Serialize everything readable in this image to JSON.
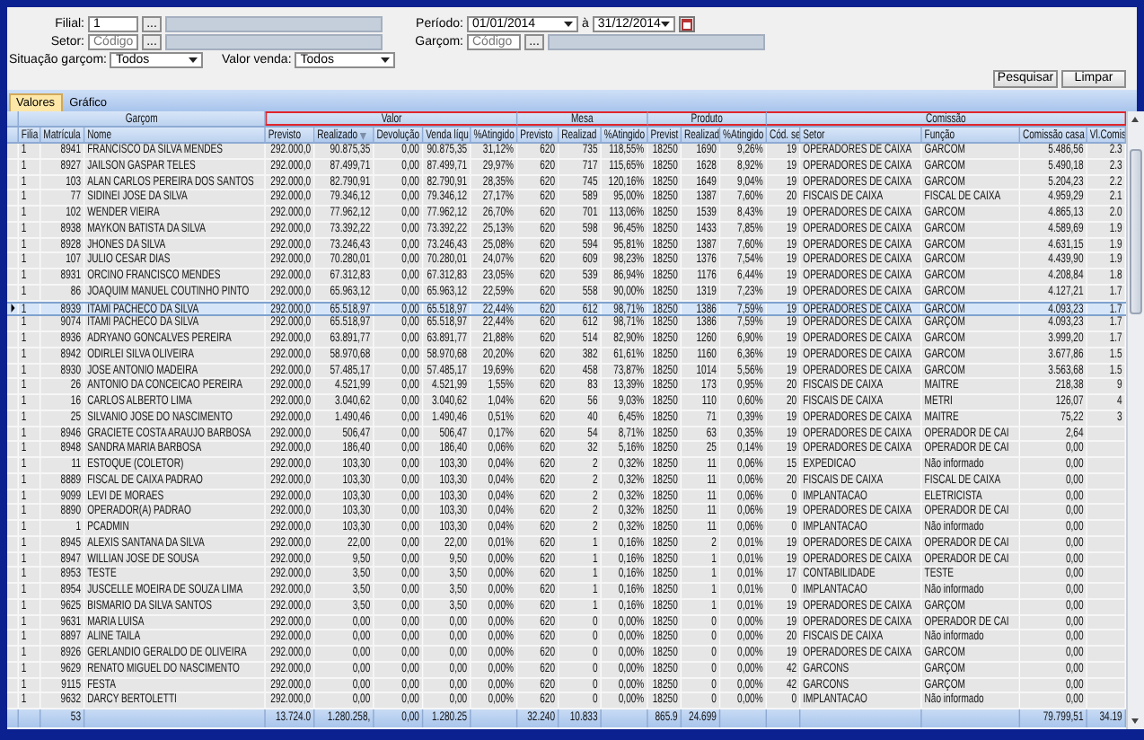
{
  "filters": {
    "filial": {
      "label": "Filial:",
      "value": "1",
      "button": "..."
    },
    "setor": {
      "label": "Setor:",
      "placeholder": "Código",
      "button": "..."
    },
    "situacao_garcom": {
      "label": "Situação garçom:",
      "value": "Todos"
    },
    "valor_venda": {
      "label": "Valor venda:",
      "value": "Todos"
    },
    "periodo": {
      "label": "Período:",
      "from": "01/01/2014",
      "separator": "à",
      "to": "31/12/2014"
    },
    "garcom": {
      "label": "Garçom:",
      "placeholder": "Código",
      "button": "..."
    }
  },
  "buttons": [
    {
      "label": "Pesquisar"
    },
    {
      "label": "Limpar"
    }
  ],
  "tabs": [
    {
      "label": "Valores",
      "selected": true
    },
    {
      "label": "Gráfico",
      "selected": false
    }
  ],
  "table": {
    "groups": [
      {
        "label": "Garçom",
        "highlighted": false,
        "columns": [
          {
            "label": "Filia",
            "sorted": false
          },
          {
            "label": "Matrícula",
            "sorted": false,
            "total": "53"
          },
          {
            "label": "Nome",
            "sorted": false
          }
        ]
      },
      {
        "label": "Valor",
        "highlighted": true,
        "columns": [
          {
            "label": "Previsto",
            "sorted": false,
            "total": "13.724.0"
          },
          {
            "label": "Realizado",
            "sorted": true,
            "total": "1.280.258,"
          },
          {
            "label": "Devolução",
            "sorted": false,
            "total": "0,00"
          },
          {
            "label": "Venda líqu",
            "sorted": false,
            "total": "1.280.25"
          },
          {
            "label": "%Atingido",
            "sorted": false
          }
        ]
      },
      {
        "label": "Mesa",
        "highlighted": true,
        "columns": [
          {
            "label": "Previsto",
            "sorted": false,
            "total": "32.240"
          },
          {
            "label": "Realizad",
            "sorted": false,
            "total": "10.833"
          },
          {
            "label": "%Atingido",
            "sorted": false
          }
        ]
      },
      {
        "label": "Produto",
        "highlighted": true,
        "columns": [
          {
            "label": "Previst",
            "sorted": false,
            "total": "865.9"
          },
          {
            "label": "Realizad",
            "sorted": false,
            "total": "24.699"
          },
          {
            "label": "%Atingido",
            "sorted": false
          }
        ]
      },
      {
        "label": "Comissão",
        "highlighted": true,
        "columns": [
          {
            "label": "Cód. se",
            "sorted": false
          },
          {
            "label": "Setor",
            "sorted": false
          },
          {
            "label": "Função",
            "sorted": false
          },
          {
            "label": "Comissão casa",
            "sorted": false,
            "total": "79.799,51"
          },
          {
            "label": "Vl.Comis",
            "sorted": false,
            "total": "34.19"
          }
        ]
      }
    ],
    "rows": [
      {
        "selected": false,
        "cells": [
          "1",
          "8941",
          "FRANCISCO DA SILVA MENDES",
          "292.000,0",
          "90.875,35",
          "0,00",
          "90.875,35",
          "31,12%",
          "620",
          "735",
          "118,55%",
          "18250",
          "1690",
          "9,26%",
          "19",
          "OPERADORES DE CAIXA",
          "GARCOM",
          "5.486,56",
          "2.3"
        ]
      },
      {
        "selected": false,
        "cells": [
          "1",
          "8927",
          "JAILSON GASPAR TELES",
          "292.000,0",
          "87.499,71",
          "0,00",
          "87.499,71",
          "29,97%",
          "620",
          "717",
          "115,65%",
          "18250",
          "1628",
          "8,92%",
          "19",
          "OPERADORES DE CAIXA",
          "GARCOM",
          "5.490,18",
          "2.3"
        ]
      },
      {
        "selected": false,
        "cells": [
          "1",
          "103",
          "ALAN CARLOS PEREIRA DOS SANTOS",
          "292.000,0",
          "82.790,91",
          "0,00",
          "82.790,91",
          "28,35%",
          "620",
          "745",
          "120,16%",
          "18250",
          "1649",
          "9,04%",
          "19",
          "OPERADORES DE CAIXA",
          "GARCOM",
          "5.204,23",
          "2.2"
        ]
      },
      {
        "selected": false,
        "cells": [
          "1",
          "77",
          "SIDINEI JOSE DA SILVA",
          "292.000,0",
          "79.346,12",
          "0,00",
          "79.346,12",
          "27,17%",
          "620",
          "589",
          "95,00%",
          "18250",
          "1387",
          "7,60%",
          "20",
          "FISCAIS DE CAIXA",
          "FISCAL DE CAIXA",
          "4.959,29",
          "2.1"
        ]
      },
      {
        "selected": false,
        "cells": [
          "1",
          "102",
          "WENDER VIEIRA",
          "292.000,0",
          "77.962,12",
          "0,00",
          "77.962,12",
          "26,70%",
          "620",
          "701",
          "113,06%",
          "18250",
          "1539",
          "8,43%",
          "19",
          "OPERADORES DE CAIXA",
          "GARCOM",
          "4.865,13",
          "2.0"
        ]
      },
      {
        "selected": false,
        "cells": [
          "1",
          "8938",
          "MAYKON BATISTA DA SILVA",
          "292.000,0",
          "73.392,22",
          "0,00",
          "73.392,22",
          "25,13%",
          "620",
          "598",
          "96,45%",
          "18250",
          "1433",
          "7,85%",
          "19",
          "OPERADORES DE CAIXA",
          "GARCOM",
          "4.589,69",
          "1.9"
        ]
      },
      {
        "selected": false,
        "cells": [
          "1",
          "8928",
          "JHONES DA SILVA",
          "292.000,0",
          "73.246,43",
          "0,00",
          "73.246,43",
          "25,08%",
          "620",
          "594",
          "95,81%",
          "18250",
          "1387",
          "7,60%",
          "19",
          "OPERADORES DE CAIXA",
          "GARCOM",
          "4.631,15",
          "1.9"
        ]
      },
      {
        "selected": false,
        "cells": [
          "1",
          "107",
          "JULIO CESAR DIAS",
          "292.000,0",
          "70.280,01",
          "0,00",
          "70.280,01",
          "24,07%",
          "620",
          "609",
          "98,23%",
          "18250",
          "1376",
          "7,54%",
          "19",
          "OPERADORES DE CAIXA",
          "GARCOM",
          "4.439,90",
          "1.9"
        ]
      },
      {
        "selected": false,
        "cells": [
          "1",
          "8931",
          "ORCINO FRANCISCO MENDES",
          "292.000,0",
          "67.312,83",
          "0,00",
          "67.312,83",
          "23,05%",
          "620",
          "539",
          "86,94%",
          "18250",
          "1176",
          "6,44%",
          "19",
          "OPERADORES DE CAIXA",
          "GARCOM",
          "4.208,84",
          "1.8"
        ]
      },
      {
        "selected": false,
        "cells": [
          "1",
          "86",
          "JOAQUIM MANUEL COUTINHO PINTO",
          "292.000,0",
          "65.963,12",
          "0,00",
          "65.963,12",
          "22,59%",
          "620",
          "558",
          "90,00%",
          "18250",
          "1319",
          "7,23%",
          "19",
          "OPERADORES DE CAIXA",
          "GARCOM",
          "4.127,21",
          "1.7"
        ]
      },
      {
        "selected": true,
        "cells": [
          "1",
          "8939",
          "ITAMI PACHECO DA SILVA",
          "292.000,0",
          "65.518,97",
          "0,00",
          "65.518,97",
          "22,44%",
          "620",
          "612",
          "98,71%",
          "18250",
          "1386",
          "7,59%",
          "19",
          "OPERADORES DE CAIXA",
          "GARCOM",
          "4.093,23",
          "1.7"
        ]
      },
      {
        "selected": false,
        "cells": [
          "1",
          "9074",
          "ITAMI PACHECO DA SILVA",
          "292.000,0",
          "65.518,97",
          "0,00",
          "65.518,97",
          "22,44%",
          "620",
          "612",
          "98,71%",
          "18250",
          "1386",
          "7,59%",
          "19",
          "OPERADORES DE CAIXA",
          "GARÇOM",
          "4.093,23",
          "1.7"
        ]
      },
      {
        "selected": false,
        "cells": [
          "1",
          "8936",
          "ADRYANO GONCALVES PEREIRA",
          "292.000,0",
          "63.891,77",
          "0,00",
          "63.891,77",
          "21,88%",
          "620",
          "514",
          "82,90%",
          "18250",
          "1260",
          "6,90%",
          "19",
          "OPERADORES DE CAIXA",
          "GARCOM",
          "3.999,20",
          "1.7"
        ]
      },
      {
        "selected": false,
        "cells": [
          "1",
          "8942",
          "ODIRLEI SILVA OLIVEIRA",
          "292.000,0",
          "58.970,68",
          "0,00",
          "58.970,68",
          "20,20%",
          "620",
          "382",
          "61,61%",
          "18250",
          "1160",
          "6,36%",
          "19",
          "OPERADORES DE CAIXA",
          "GARCOM",
          "3.677,86",
          "1.5"
        ]
      },
      {
        "selected": false,
        "cells": [
          "1",
          "8930",
          "JOSE ANTONIO MADEIRA",
          "292.000,0",
          "57.485,17",
          "0,00",
          "57.485,17",
          "19,69%",
          "620",
          "458",
          "73,87%",
          "18250",
          "1014",
          "5,56%",
          "19",
          "OPERADORES DE CAIXA",
          "GARCOM",
          "3.563,68",
          "1.5"
        ]
      },
      {
        "selected": false,
        "cells": [
          "1",
          "26",
          "ANTONIO DA CONCEICAO PEREIRA",
          "292.000,0",
          "4.521,99",
          "0,00",
          "4.521,99",
          "1,55%",
          "620",
          "83",
          "13,39%",
          "18250",
          "173",
          "0,95%",
          "20",
          "FISCAIS DE CAIXA",
          "MAITRE",
          "218,38",
          "9"
        ]
      },
      {
        "selected": false,
        "cells": [
          "1",
          "16",
          "CARLOS ALBERTO LIMA",
          "292.000,0",
          "3.040,62",
          "0,00",
          "3.040,62",
          "1,04%",
          "620",
          "56",
          "9,03%",
          "18250",
          "110",
          "0,60%",
          "20",
          "FISCAIS DE CAIXA",
          "METRI",
          "126,07",
          "4"
        ]
      },
      {
        "selected": false,
        "cells": [
          "1",
          "25",
          "SILVANIO JOSE DO NASCIMENTO",
          "292.000,0",
          "1.490,46",
          "0,00",
          "1.490,46",
          "0,51%",
          "620",
          "40",
          "6,45%",
          "18250",
          "71",
          "0,39%",
          "19",
          "OPERADORES DE CAIXA",
          "MAITRE",
          "75,22",
          "3"
        ]
      },
      {
        "selected": false,
        "cells": [
          "1",
          "8946",
          "GRACIETE COSTA ARAUJO BARBOSA",
          "292.000,0",
          "506,47",
          "0,00",
          "506,47",
          "0,17%",
          "620",
          "54",
          "8,71%",
          "18250",
          "63",
          "0,35%",
          "19",
          "OPERADORES DE CAIXA",
          "OPERADOR DE CAI",
          "2,64"
        ]
      },
      {
        "selected": false,
        "cells": [
          "1",
          "8948",
          "SANDRA MARIA BARBOSA",
          "292.000,0",
          "186,40",
          "0,00",
          "186,40",
          "0,06%",
          "620",
          "32",
          "5,16%",
          "18250",
          "25",
          "0,14%",
          "19",
          "OPERADORES DE CAIXA",
          "OPERADOR DE CAI",
          "0,00"
        ]
      },
      {
        "selected": false,
        "cells": [
          "1",
          "11",
          "ESTOQUE (COLETOR)",
          "292.000,0",
          "103,30",
          "0,00",
          "103,30",
          "0,04%",
          "620",
          "2",
          "0,32%",
          "18250",
          "11",
          "0,06%",
          "15",
          "EXPEDICAO",
          "Não informado",
          "0,00"
        ]
      },
      {
        "selected": false,
        "cells": [
          "1",
          "8889",
          "FISCAL DE CAIXA PADRAO",
          "292.000,0",
          "103,30",
          "0,00",
          "103,30",
          "0,04%",
          "620",
          "2",
          "0,32%",
          "18250",
          "11",
          "0,06%",
          "20",
          "FISCAIS DE CAIXA",
          "FISCAL DE CAIXA",
          "0,00"
        ]
      },
      {
        "selected": false,
        "cells": [
          "1",
          "9099",
          "LEVI DE MORAES",
          "292.000,0",
          "103,30",
          "0,00",
          "103,30",
          "0,04%",
          "620",
          "2",
          "0,32%",
          "18250",
          "11",
          "0,06%",
          "0",
          "IMPLANTACAO",
          "ELETRICISTA",
          "0,00"
        ]
      },
      {
        "selected": false,
        "cells": [
          "1",
          "8890",
          "OPERADOR(A) PADRAO",
          "292.000,0",
          "103,30",
          "0,00",
          "103,30",
          "0,04%",
          "620",
          "2",
          "0,32%",
          "18250",
          "11",
          "0,06%",
          "19",
          "OPERADORES DE CAIXA",
          "OPERADOR DE CAI",
          "0,00"
        ]
      },
      {
        "selected": false,
        "cells": [
          "1",
          "1",
          "PCADMIN",
          "292.000,0",
          "103,30",
          "0,00",
          "103,30",
          "0,04%",
          "620",
          "2",
          "0,32%",
          "18250",
          "11",
          "0,06%",
          "0",
          "IMPLANTACAO",
          "Não informado",
          "0,00"
        ]
      },
      {
        "selected": false,
        "cells": [
          "1",
          "8945",
          "ALEXIS SANTANA DA SILVA",
          "292.000,0",
          "22,00",
          "0,00",
          "22,00",
          "0,01%",
          "620",
          "1",
          "0,16%",
          "18250",
          "2",
          "0,01%",
          "19",
          "OPERADORES DE CAIXA",
          "OPERADOR DE CAI",
          "0,00"
        ]
      },
      {
        "selected": false,
        "cells": [
          "1",
          "8947",
          "WILLIAN JOSE DE SOUSA",
          "292.000,0",
          "9,50",
          "0,00",
          "9,50",
          "0,00%",
          "620",
          "1",
          "0,16%",
          "18250",
          "1",
          "0,01%",
          "19",
          "OPERADORES DE CAIXA",
          "OPERADOR DE CAI",
          "0,00"
        ]
      },
      {
        "selected": false,
        "cells": [
          "1",
          "8953",
          "TESTE",
          "292.000,0",
          "3,50",
          "0,00",
          "3,50",
          "0,00%",
          "620",
          "1",
          "0,16%",
          "18250",
          "1",
          "0,01%",
          "17",
          "CONTABILIDADE",
          "TESTE",
          "0,00"
        ]
      },
      {
        "selected": false,
        "cells": [
          "1",
          "8954",
          "JUSCELLE MOEIRA DE SOUZA LIMA",
          "292.000,0",
          "3,50",
          "0,00",
          "3,50",
          "0,00%",
          "620",
          "1",
          "0,16%",
          "18250",
          "1",
          "0,01%",
          "0",
          "IMPLANTACAO",
          "Não informado",
          "0,00"
        ]
      },
      {
        "selected": false,
        "cells": [
          "1",
          "9625",
          "BISMARIO DA SILVA SANTOS",
          "292.000,0",
          "3,50",
          "0,00",
          "3,50",
          "0,00%",
          "620",
          "1",
          "0,16%",
          "18250",
          "1",
          "0,01%",
          "19",
          "OPERADORES DE CAIXA",
          "GARÇOM",
          "0,00"
        ]
      },
      {
        "selected": false,
        "cells": [
          "1",
          "9631",
          "MARIA LUISA",
          "292.000,0",
          "0,00",
          "0,00",
          "0,00",
          "0,00%",
          "620",
          "0",
          "0,00%",
          "18250",
          "0",
          "0,00%",
          "19",
          "OPERADORES DE CAIXA",
          "OPERADOR DE CAI",
          "0,00"
        ]
      },
      {
        "selected": false,
        "cells": [
          "1",
          "8897",
          "ALINE TAILA",
          "292.000,0",
          "0,00",
          "0,00",
          "0,00",
          "0,00%",
          "620",
          "0",
          "0,00%",
          "18250",
          "0",
          "0,00%",
          "20",
          "FISCAIS DE CAIXA",
          "Não informado",
          "0,00"
        ]
      },
      {
        "selected": false,
        "cells": [
          "1",
          "8926",
          "GERLANDIO GERALDO DE OLIVEIRA",
          "292.000,0",
          "0,00",
          "0,00",
          "0,00",
          "0,00%",
          "620",
          "0",
          "0,00%",
          "18250",
          "0",
          "0,00%",
          "19",
          "OPERADORES DE CAIXA",
          "GARCOM",
          "0,00"
        ]
      },
      {
        "selected": false,
        "cells": [
          "1",
          "9629",
          "RENATO MIGUEL DO NASCIMENTO",
          "292.000,0",
          "0,00",
          "0,00",
          "0,00",
          "0,00%",
          "620",
          "0",
          "0,00%",
          "18250",
          "0",
          "0,00%",
          "42",
          "GARCONS",
          "GARÇOM",
          "0,00"
        ]
      },
      {
        "selected": false,
        "cells": [
          "1",
          "9115",
          "FESTA",
          "292.000,0",
          "0,00",
          "0,00",
          "0,00",
          "0,00%",
          "620",
          "0",
          "0,00%",
          "18250",
          "0",
          "0,00%",
          "42",
          "GARCONS",
          "GARÇOM",
          "0,00"
        ]
      },
      {
        "selected": false,
        "cells": [
          "1",
          "9632",
          "DARCY BERTOLETTI",
          "292.000,0",
          "0,00",
          "0,00",
          "0,00",
          "0,00%",
          "620",
          "0",
          "0,00%",
          "18250",
          "0",
          "0,00%",
          "0",
          "IMPLANTACAO",
          "Não informado",
          "0,00"
        ]
      }
    ]
  }
}
